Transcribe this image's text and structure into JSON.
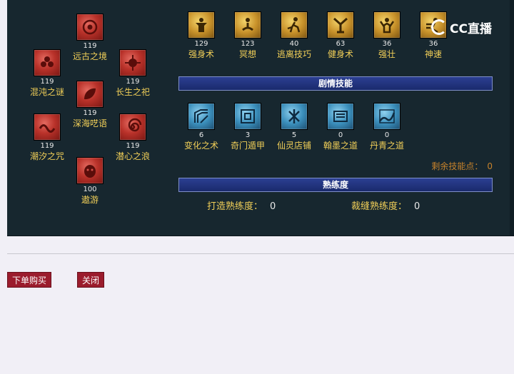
{
  "left_skills": [
    {
      "name": "远古之境",
      "level": "119"
    },
    {
      "name": "混沌之谜",
      "level": "119"
    },
    {
      "name": "长生之祀",
      "level": "119"
    },
    {
      "name": "深海呓语",
      "level": "119"
    },
    {
      "name": "潮汐之咒",
      "level": "119"
    },
    {
      "name": "潜心之浪",
      "level": "119"
    },
    {
      "name": "遨游",
      "level": "100"
    }
  ],
  "top_skills": [
    {
      "name": "强身术",
      "level": "129"
    },
    {
      "name": "冥想",
      "level": "123"
    },
    {
      "name": "逃离技巧",
      "level": "40"
    },
    {
      "name": "健身术",
      "level": "63"
    },
    {
      "name": "强壮",
      "level": "36"
    },
    {
      "name": "神速",
      "level": "36"
    }
  ],
  "story_section": {
    "title": "剧情技能",
    "skills": [
      {
        "name": "变化之术",
        "level": "6"
      },
      {
        "name": "奇门遁甲",
        "level": "3"
      },
      {
        "name": "仙灵店铺",
        "level": "5"
      },
      {
        "name": "翰墨之道",
        "level": "0"
      },
      {
        "name": "丹青之道",
        "level": "0"
      }
    ],
    "remaining_label": "剩余技能点：",
    "remaining_value": "0"
  },
  "proficiency": {
    "title": "熟练度",
    "forging_label": "打造熟练度：",
    "forging_value": "0",
    "tailoring_label": "裁缝熟练度：",
    "tailoring_value": "0"
  },
  "buttons": {
    "buy": "下单购买",
    "close": "关闭"
  },
  "watermark": {
    "text": "CC直播"
  },
  "colors": {
    "panel_bg": "#17272f",
    "skill_name": "#f1cf58",
    "section_bar": "#22337f",
    "remaining": "#c6822b",
    "button_bg": "#9b1c2d"
  }
}
